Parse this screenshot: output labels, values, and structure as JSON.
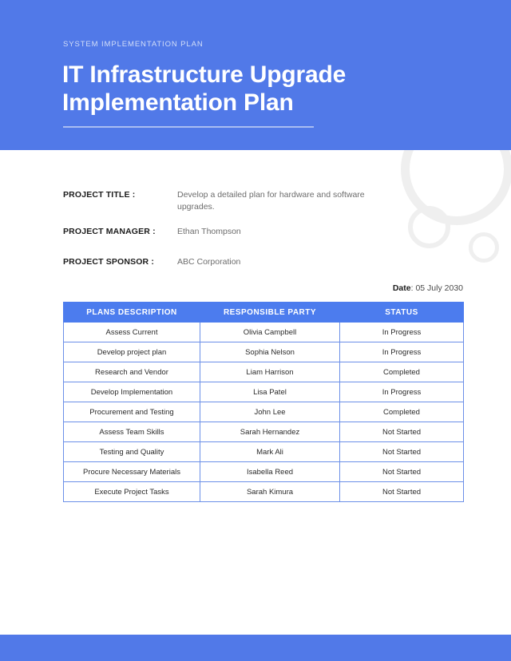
{
  "theme": {
    "brand_blue": "#5179e8",
    "table_header_blue": "#4c7cee",
    "table_border_blue": "#6b8fe8",
    "decoration_gray": "#efefef",
    "eyebrow_color": "#d3def8",
    "body_gray": "#6d6d6d"
  },
  "header": {
    "eyebrow": "SYSTEM IMPLEMENTATION PLAN",
    "title_line1": "IT Infrastructure Upgrade",
    "title_line2": "Implementation Plan"
  },
  "meta": {
    "project_title_label": "PROJECT TITLE :",
    "project_title_value": "Develop a detailed plan for hardware and software upgrades.",
    "project_manager_label": "PROJECT MANAGER :",
    "project_manager_value": "Ethan Thompson",
    "project_sponsor_label": "PROJECT SPONSOR :",
    "project_sponsor_value": "ABC Corporation"
  },
  "date": {
    "key": "Date",
    "separator": ": ",
    "value": "05 July 2030"
  },
  "table": {
    "columns": [
      "PLANS DESCRIPTION",
      "RESPONSIBLE PARTY",
      "STATUS"
    ],
    "rows": [
      {
        "description": "Assess Current",
        "party": "Olivia Campbell",
        "status": "In Progress"
      },
      {
        "description": "Develop project plan",
        "party": "Sophia Nelson",
        "status": "In Progress"
      },
      {
        "description": "Research and Vendor",
        "party": "Liam Harrison",
        "status": "Completed"
      },
      {
        "description": "Develop Implementation",
        "party": "Lisa Patel",
        "status": "In Progress"
      },
      {
        "description": "Procurement and Testing",
        "party": "John Lee",
        "status": "Completed"
      },
      {
        "description": "Assess Team Skills",
        "party": "Sarah Hernandez",
        "status": "Not Started"
      },
      {
        "description": "Testing and Quality",
        "party": "Mark Ali",
        "status": "Not Started"
      },
      {
        "description": "Procure Necessary Materials",
        "party": "Isabella Reed",
        "status": "Not Started"
      },
      {
        "description": "Execute Project Tasks",
        "party": "Sarah Kimura",
        "status": "Not Started"
      }
    ]
  }
}
